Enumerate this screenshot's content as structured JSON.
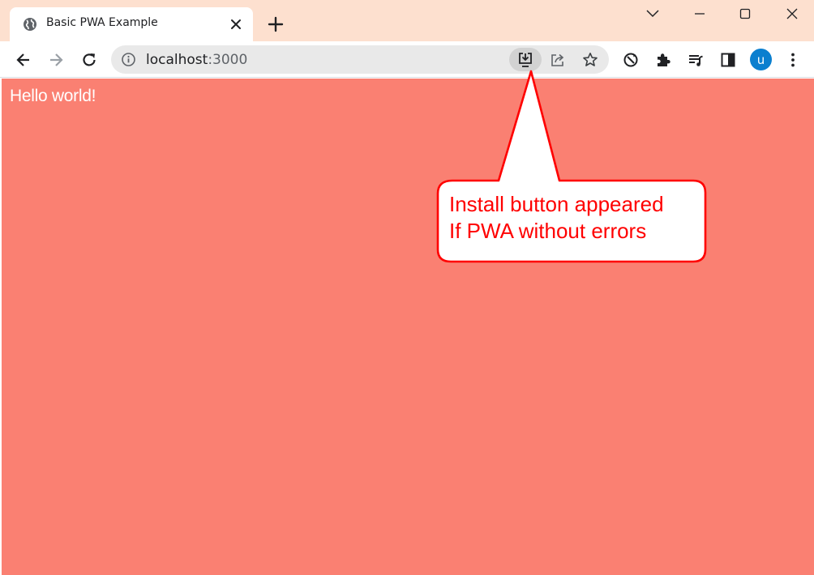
{
  "tab": {
    "title": "Basic PWA Example",
    "favicon": "globe-icon"
  },
  "address_bar": {
    "host": "localhost",
    "port": ":3000"
  },
  "profile": {
    "initial": "u",
    "color": "#0b7fcf"
  },
  "page": {
    "background": "#fa8072",
    "heading": "Hello world!"
  },
  "annotation": {
    "line1": "Install button appeared",
    "line2": "If PWA without errors",
    "color": "#ff0000"
  },
  "icons": {
    "toolbar": [
      "back-icon",
      "forward-icon",
      "reload-icon"
    ],
    "omnibox": [
      "info-icon",
      "install-app-icon",
      "share-icon",
      "bookmark-star-icon"
    ],
    "extensions": [
      "sync-icon",
      "extensions-puzzle-icon",
      "media-queue-icon",
      "side-panel-icon",
      "more-menu-icon"
    ],
    "window": [
      "tab-search-chevron-icon",
      "minimize-icon",
      "maximize-icon",
      "close-window-icon"
    ]
  }
}
